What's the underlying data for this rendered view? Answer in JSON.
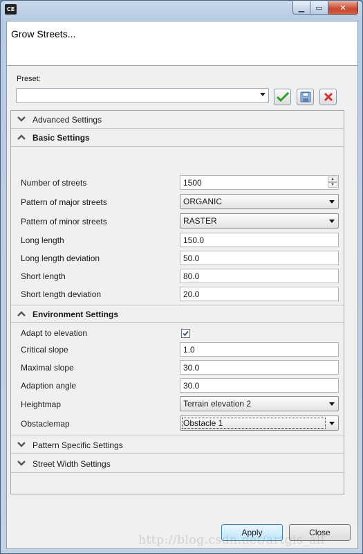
{
  "window": {
    "app_icon": "CE",
    "title": "Grow Streets..."
  },
  "preset": {
    "label": "Preset:",
    "value": ""
  },
  "sections": {
    "advanced": {
      "title": "Advanced Settings"
    },
    "basic": {
      "title": "Basic Settings",
      "number_of_streets": {
        "label": "Number of streets",
        "value": "1500"
      },
      "major_pattern": {
        "label": "Pattern of major streets",
        "value": "ORGANIC"
      },
      "minor_pattern": {
        "label": "Pattern of minor streets",
        "value": "RASTER"
      },
      "long_length": {
        "label": "Long length",
        "value": "150.0"
      },
      "long_length_dev": {
        "label": "Long length deviation",
        "value": "50.0"
      },
      "short_length": {
        "label": "Short length",
        "value": "80.0"
      },
      "short_length_dev": {
        "label": "Short length deviation",
        "value": "20.0"
      }
    },
    "environment": {
      "title": "Environment Settings",
      "adapt_to_elevation": {
        "label": "Adapt to elevation",
        "checked": true
      },
      "critical_slope": {
        "label": "Critical slope",
        "value": "1.0"
      },
      "maximal_slope": {
        "label": "Maximal slope",
        "value": "30.0"
      },
      "adaption_angle": {
        "label": "Adaption angle",
        "value": "30.0"
      },
      "heightmap": {
        "label": "Heightmap",
        "value": "Terrain elevation 2"
      },
      "obstaclemap": {
        "label": "Obstaclemap",
        "value": "Obstacle 1"
      }
    },
    "pattern_specific": {
      "title": "Pattern Specific Settings"
    },
    "street_width": {
      "title": "Street Width Settings"
    }
  },
  "buttons": {
    "apply": "Apply",
    "close": "Close"
  },
  "watermark": "http://blog.csdn.net/artgis_all",
  "colors": {
    "accent_check": "#2e9e2e",
    "delete_red": "#d03030",
    "save_blue": "#3a6fb0"
  }
}
